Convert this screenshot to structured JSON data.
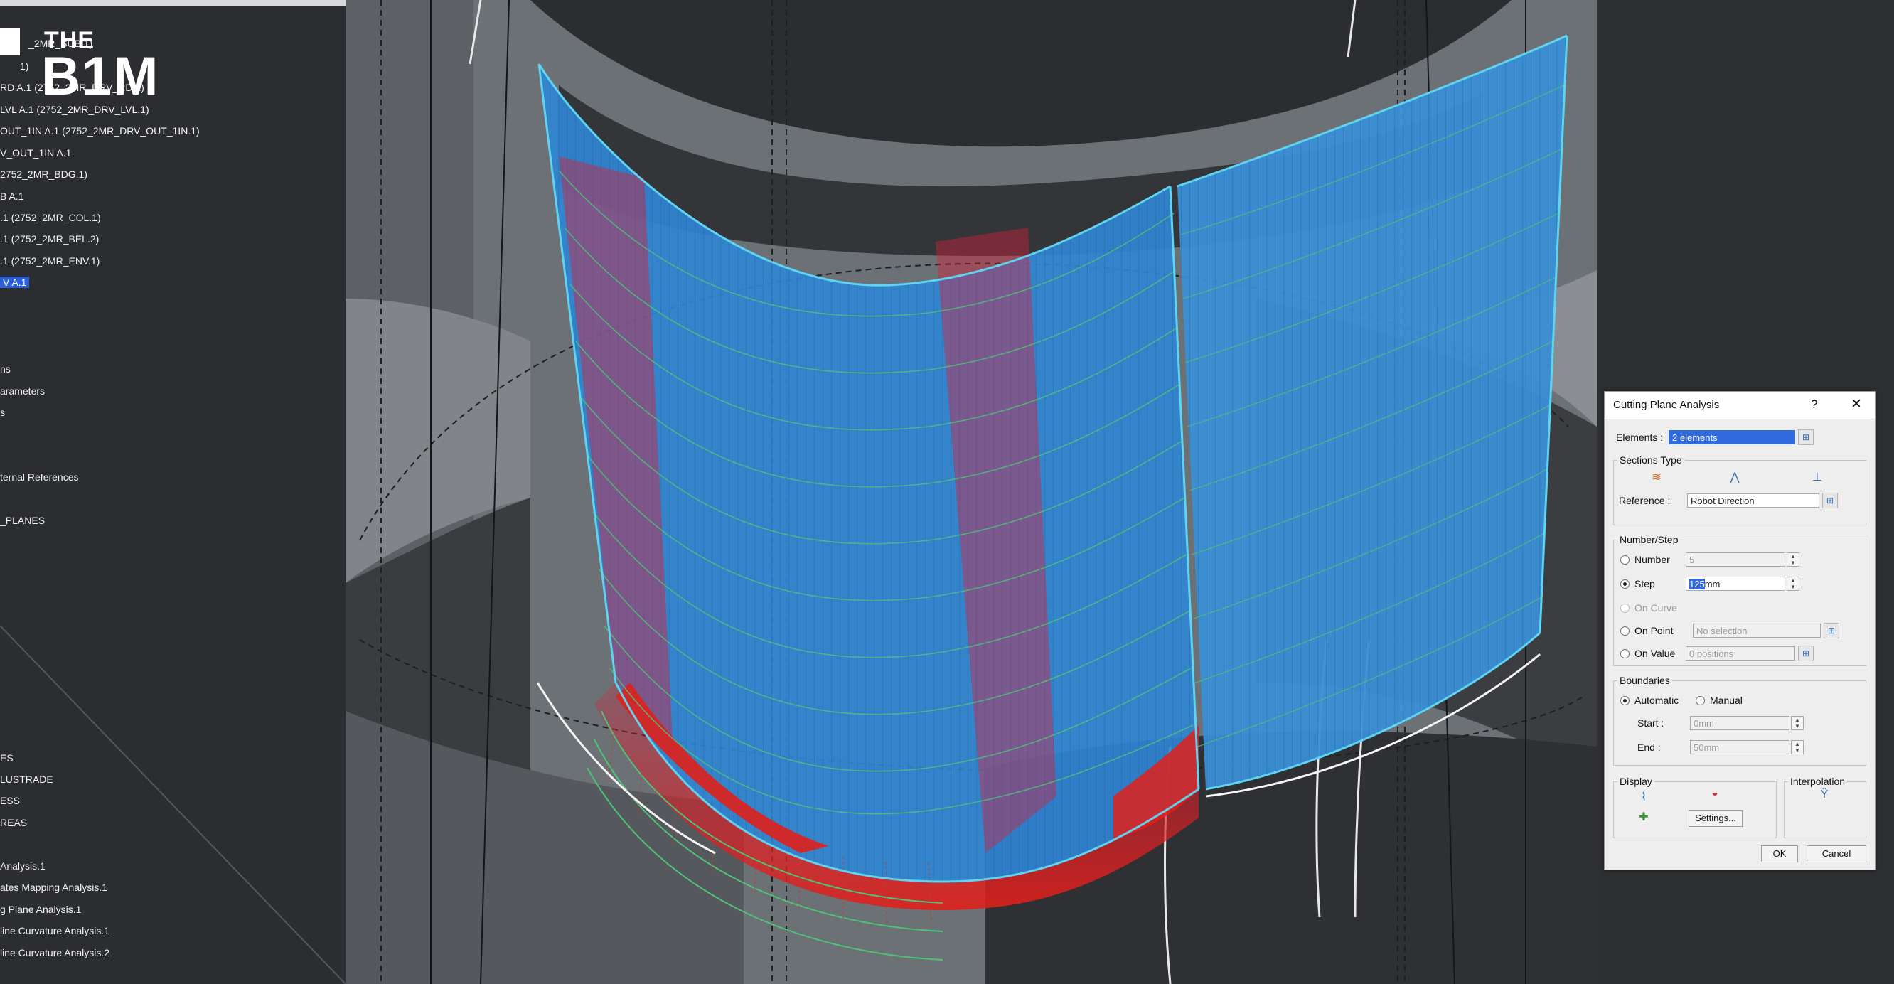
{
  "logo": {
    "line1": "THE",
    "line2": "B1M"
  },
  "tree": {
    "items": [
      "_2MR_SUB.1)",
      "1)",
      "RD A.1 (2752_2MR_DRV_RD.1)",
      "LVL A.1 (2752_2MR_DRV_LVL.1)",
      "OUT_1IN A.1 (2752_2MR_DRV_OUT_1IN.1)",
      "V_OUT_1IN A.1",
      "2752_2MR_BDG.1)",
      "B A.1",
      ".1 (2752_2MR_COL.1)",
      ".1 (2752_2MR_BEL.2)",
      ".1 (2752_2MR_ENV.1)",
      "V A.1",
      "ns",
      "arameters",
      "s",
      "ternal References",
      "_PLANES",
      "ES",
      "LUSTRADE",
      "ESS",
      "REAS",
      "Analysis.1",
      "ates Mapping Analysis.1",
      "g Plane Analysis.1",
      "line Curvature Analysis.1",
      "line Curvature Analysis.2"
    ]
  },
  "dialog": {
    "title": "Cutting Plane Analysis",
    "help": "?",
    "close": "✕",
    "elements_label": "Elements :",
    "elements_value": "2 elements",
    "sections_type": {
      "title": "Sections Type",
      "reference_label": "Reference :",
      "reference_value": "Robot Direction"
    },
    "number_step": {
      "title": "Number/Step",
      "number_label": "Number",
      "number_value": "5",
      "step_label": "Step",
      "step_value_selected": "125",
      "step_value_rest": "mm",
      "on_curve_label": "On Curve",
      "on_point_label": "On Point",
      "on_point_value": "No selection",
      "on_value_label": "On Value",
      "on_value_value": "0 positions"
    },
    "boundaries": {
      "title": "Boundaries",
      "automatic_label": "Automatic",
      "manual_label": "Manual",
      "start_label": "Start :",
      "start_value": "0mm",
      "end_label": "End :",
      "end_value": "50mm"
    },
    "display": {
      "title": "Display",
      "settings_label": "Settings..."
    },
    "interpolation": {
      "title": "Interpolation"
    },
    "ok_label": "OK",
    "cancel_label": "Cancel"
  },
  "colors": {
    "surface_blue": "#2f86d6",
    "highlight_red": "#e0201a",
    "section_green": "#4ec17a",
    "edge_cyan": "#5fd3f0",
    "selection_blue": "#2f6ae0"
  }
}
